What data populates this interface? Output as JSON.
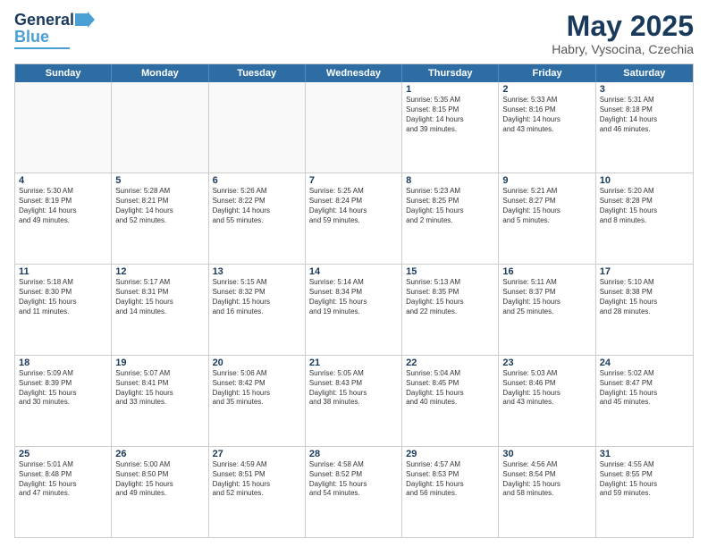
{
  "logo": {
    "line1": "General",
    "line2": "Blue"
  },
  "title": "May 2025",
  "subtitle": "Habry, Vysocina, Czechia",
  "days": [
    "Sunday",
    "Monday",
    "Tuesday",
    "Wednesday",
    "Thursday",
    "Friday",
    "Saturday"
  ],
  "weeks": [
    [
      {
        "day": "",
        "text": ""
      },
      {
        "day": "",
        "text": ""
      },
      {
        "day": "",
        "text": ""
      },
      {
        "day": "",
        "text": ""
      },
      {
        "day": "1",
        "text": "Sunrise: 5:35 AM\nSunset: 8:15 PM\nDaylight: 14 hours\nand 39 minutes."
      },
      {
        "day": "2",
        "text": "Sunrise: 5:33 AM\nSunset: 8:16 PM\nDaylight: 14 hours\nand 43 minutes."
      },
      {
        "day": "3",
        "text": "Sunrise: 5:31 AM\nSunset: 8:18 PM\nDaylight: 14 hours\nand 46 minutes."
      }
    ],
    [
      {
        "day": "4",
        "text": "Sunrise: 5:30 AM\nSunset: 8:19 PM\nDaylight: 14 hours\nand 49 minutes."
      },
      {
        "day": "5",
        "text": "Sunrise: 5:28 AM\nSunset: 8:21 PM\nDaylight: 14 hours\nand 52 minutes."
      },
      {
        "day": "6",
        "text": "Sunrise: 5:26 AM\nSunset: 8:22 PM\nDaylight: 14 hours\nand 55 minutes."
      },
      {
        "day": "7",
        "text": "Sunrise: 5:25 AM\nSunset: 8:24 PM\nDaylight: 14 hours\nand 59 minutes."
      },
      {
        "day": "8",
        "text": "Sunrise: 5:23 AM\nSunset: 8:25 PM\nDaylight: 15 hours\nand 2 minutes."
      },
      {
        "day": "9",
        "text": "Sunrise: 5:21 AM\nSunset: 8:27 PM\nDaylight: 15 hours\nand 5 minutes."
      },
      {
        "day": "10",
        "text": "Sunrise: 5:20 AM\nSunset: 8:28 PM\nDaylight: 15 hours\nand 8 minutes."
      }
    ],
    [
      {
        "day": "11",
        "text": "Sunrise: 5:18 AM\nSunset: 8:30 PM\nDaylight: 15 hours\nand 11 minutes."
      },
      {
        "day": "12",
        "text": "Sunrise: 5:17 AM\nSunset: 8:31 PM\nDaylight: 15 hours\nand 14 minutes."
      },
      {
        "day": "13",
        "text": "Sunrise: 5:15 AM\nSunset: 8:32 PM\nDaylight: 15 hours\nand 16 minutes."
      },
      {
        "day": "14",
        "text": "Sunrise: 5:14 AM\nSunset: 8:34 PM\nDaylight: 15 hours\nand 19 minutes."
      },
      {
        "day": "15",
        "text": "Sunrise: 5:13 AM\nSunset: 8:35 PM\nDaylight: 15 hours\nand 22 minutes."
      },
      {
        "day": "16",
        "text": "Sunrise: 5:11 AM\nSunset: 8:37 PM\nDaylight: 15 hours\nand 25 minutes."
      },
      {
        "day": "17",
        "text": "Sunrise: 5:10 AM\nSunset: 8:38 PM\nDaylight: 15 hours\nand 28 minutes."
      }
    ],
    [
      {
        "day": "18",
        "text": "Sunrise: 5:09 AM\nSunset: 8:39 PM\nDaylight: 15 hours\nand 30 minutes."
      },
      {
        "day": "19",
        "text": "Sunrise: 5:07 AM\nSunset: 8:41 PM\nDaylight: 15 hours\nand 33 minutes."
      },
      {
        "day": "20",
        "text": "Sunrise: 5:06 AM\nSunset: 8:42 PM\nDaylight: 15 hours\nand 35 minutes."
      },
      {
        "day": "21",
        "text": "Sunrise: 5:05 AM\nSunset: 8:43 PM\nDaylight: 15 hours\nand 38 minutes."
      },
      {
        "day": "22",
        "text": "Sunrise: 5:04 AM\nSunset: 8:45 PM\nDaylight: 15 hours\nand 40 minutes."
      },
      {
        "day": "23",
        "text": "Sunrise: 5:03 AM\nSunset: 8:46 PM\nDaylight: 15 hours\nand 43 minutes."
      },
      {
        "day": "24",
        "text": "Sunrise: 5:02 AM\nSunset: 8:47 PM\nDaylight: 15 hours\nand 45 minutes."
      }
    ],
    [
      {
        "day": "25",
        "text": "Sunrise: 5:01 AM\nSunset: 8:48 PM\nDaylight: 15 hours\nand 47 minutes."
      },
      {
        "day": "26",
        "text": "Sunrise: 5:00 AM\nSunset: 8:50 PM\nDaylight: 15 hours\nand 49 minutes."
      },
      {
        "day": "27",
        "text": "Sunrise: 4:59 AM\nSunset: 8:51 PM\nDaylight: 15 hours\nand 52 minutes."
      },
      {
        "day": "28",
        "text": "Sunrise: 4:58 AM\nSunset: 8:52 PM\nDaylight: 15 hours\nand 54 minutes."
      },
      {
        "day": "29",
        "text": "Sunrise: 4:57 AM\nSunset: 8:53 PM\nDaylight: 15 hours\nand 56 minutes."
      },
      {
        "day": "30",
        "text": "Sunrise: 4:56 AM\nSunset: 8:54 PM\nDaylight: 15 hours\nand 58 minutes."
      },
      {
        "day": "31",
        "text": "Sunrise: 4:55 AM\nSunset: 8:55 PM\nDaylight: 15 hours\nand 59 minutes."
      }
    ]
  ]
}
